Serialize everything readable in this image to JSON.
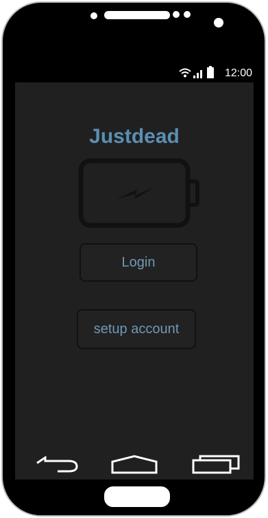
{
  "status_bar": {
    "time": "12:00"
  },
  "app": {
    "title": "Justdead",
    "login_label": "Login",
    "setup_label": "setup account"
  },
  "icons": {
    "battery": "battery-charging-icon",
    "back": "back-icon",
    "home": "home-icon",
    "recent": "recent-apps-icon",
    "wifi": "wifi-icon",
    "signal": "signal-icon",
    "status_battery": "battery-icon"
  },
  "colors": {
    "accent": "#5a8fb3",
    "screen_bg": "#202020"
  }
}
